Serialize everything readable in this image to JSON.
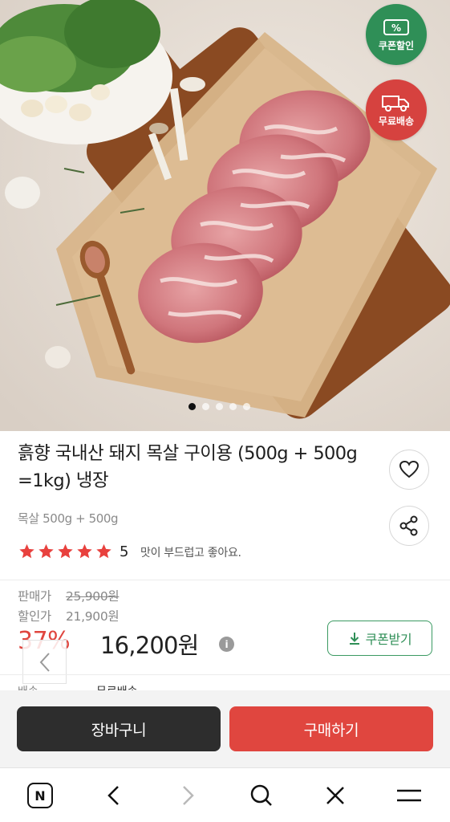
{
  "hero": {
    "badges": {
      "coupon": {
        "symbol": "%",
        "label": "쿠폰할인",
        "color": "#2f8f57"
      },
      "shipping": {
        "label": "무료배송",
        "color": "#d6423f",
        "icon": "truck-icon"
      }
    },
    "carousel": {
      "total": 5,
      "active_index": 1
    }
  },
  "product": {
    "title": "흙향 국내산 돼지 목살 구이용 (500g + 500g =1kg) 냉장",
    "option": "목살 500g + 500g",
    "rating": {
      "stars": 5,
      "score": "5"
    },
    "review_snippet": "맛이 부드럽고 좋아요."
  },
  "price": {
    "sale_label": "판매가",
    "sale_value": "25,900원",
    "discount_label": "할인가",
    "discount_value": "21,900원",
    "discount_rate": "37%",
    "final_price": "16,200원",
    "info_icon_glyph": "i",
    "coupon_button": "쿠폰받기"
  },
  "shipping_row": {
    "label": "배송",
    "value": "무료배송"
  },
  "actions": {
    "cart": "장바구니",
    "buy": "구매하기"
  },
  "browser_nav": {
    "home_glyph": "N",
    "items": [
      "naver-home-icon",
      "back-arrow-icon",
      "forward-arrow-icon",
      "search-icon",
      "close-icon",
      "menu-icon"
    ]
  },
  "colors": {
    "accent_red": "#e0463f",
    "accent_green": "#2f8f57",
    "dark": "#2d2d2d"
  }
}
